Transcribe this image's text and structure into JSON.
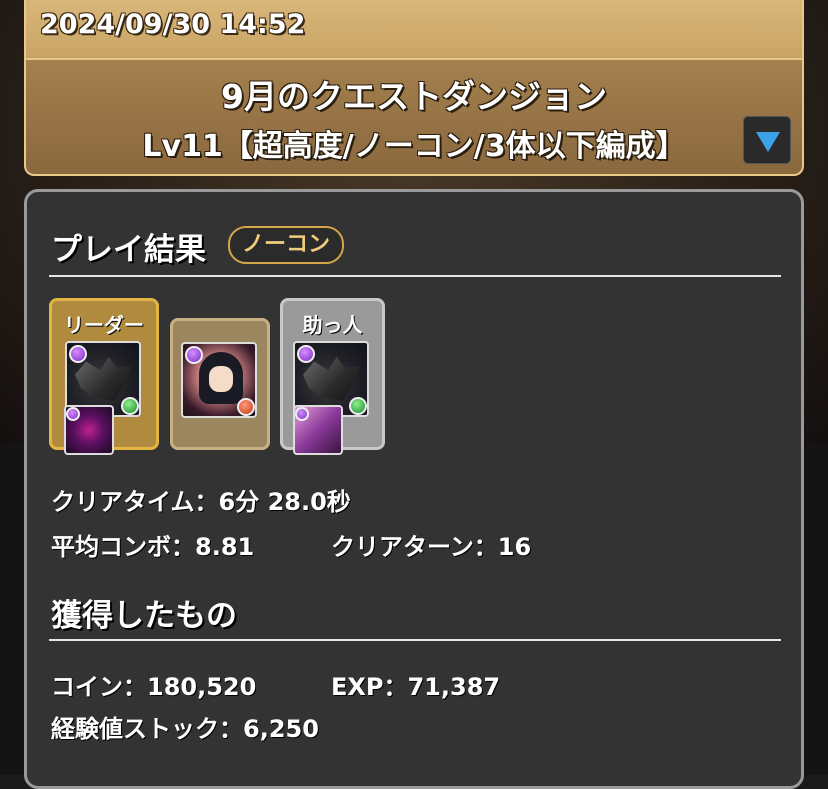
{
  "header": {
    "datetime": "2024/09/30 14:52",
    "dungeon_title": "9月のクエストダンジョン",
    "dungeon_subtitle": "Lv11【超高度/ノーコン/3体以下編成】"
  },
  "result": {
    "section_title": "プレイ結果",
    "badge": "ノーコン",
    "team": {
      "leader_label": "リーダー",
      "helper_label": "助っ人"
    },
    "clear_time": "クリアタイム：6分 28.0秒",
    "avg_combo": "平均コンボ：8.81",
    "clear_turns": "クリアターン：16"
  },
  "rewards": {
    "section_title": "獲得したもの",
    "coins": "コイン：180,520",
    "exp": "EXP：71,387",
    "exp_stock": "経験値ストック：6,250"
  },
  "icons": {
    "expand": "triangle-down-icon",
    "accent_color": "#3aa3e8"
  }
}
